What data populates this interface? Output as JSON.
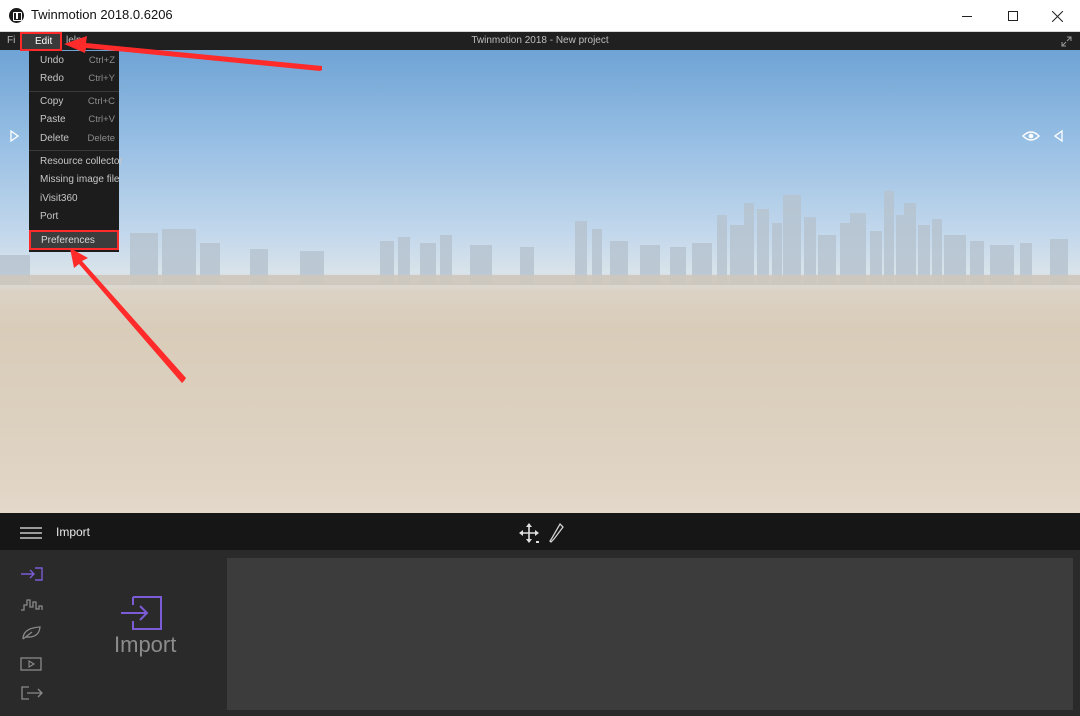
{
  "window": {
    "title": "Twinmotion 2018.0.6206"
  },
  "menubar": {
    "file_label": "Fi",
    "edit_label": "Edit",
    "help_label": "lelp",
    "project_title": "Twinmotion 2018 - New project"
  },
  "edit_menu": {
    "items": [
      {
        "label": "Undo",
        "shortcut": "Ctrl+Z"
      },
      {
        "label": "Redo",
        "shortcut": "Ctrl+Y"
      },
      {
        "label": "Copy",
        "shortcut": "Ctrl+C"
      },
      {
        "label": "Paste",
        "shortcut": "Ctrl+V"
      },
      {
        "label": "Delete",
        "shortcut": "Delete"
      },
      {
        "label": "Resource collector",
        "shortcut": ""
      },
      {
        "label": "Missing image file",
        "shortcut": ""
      },
      {
        "label": "iVisit360",
        "shortcut": ""
      },
      {
        "label": "Port",
        "shortcut": ""
      }
    ],
    "highlighted_item": "Preferences"
  },
  "toolbar": {
    "section_label": "Import"
  },
  "panel": {
    "sidebar_icons": [
      "import-icon",
      "landscape-icon",
      "leaf-icon",
      "media-icon",
      "export-icon"
    ],
    "active_tool_label": "Import"
  },
  "colors": {
    "accent_purple": "#7b5bd6",
    "annotation_red": "#ff2a2a",
    "panel_dark": "#2a2a2a"
  }
}
